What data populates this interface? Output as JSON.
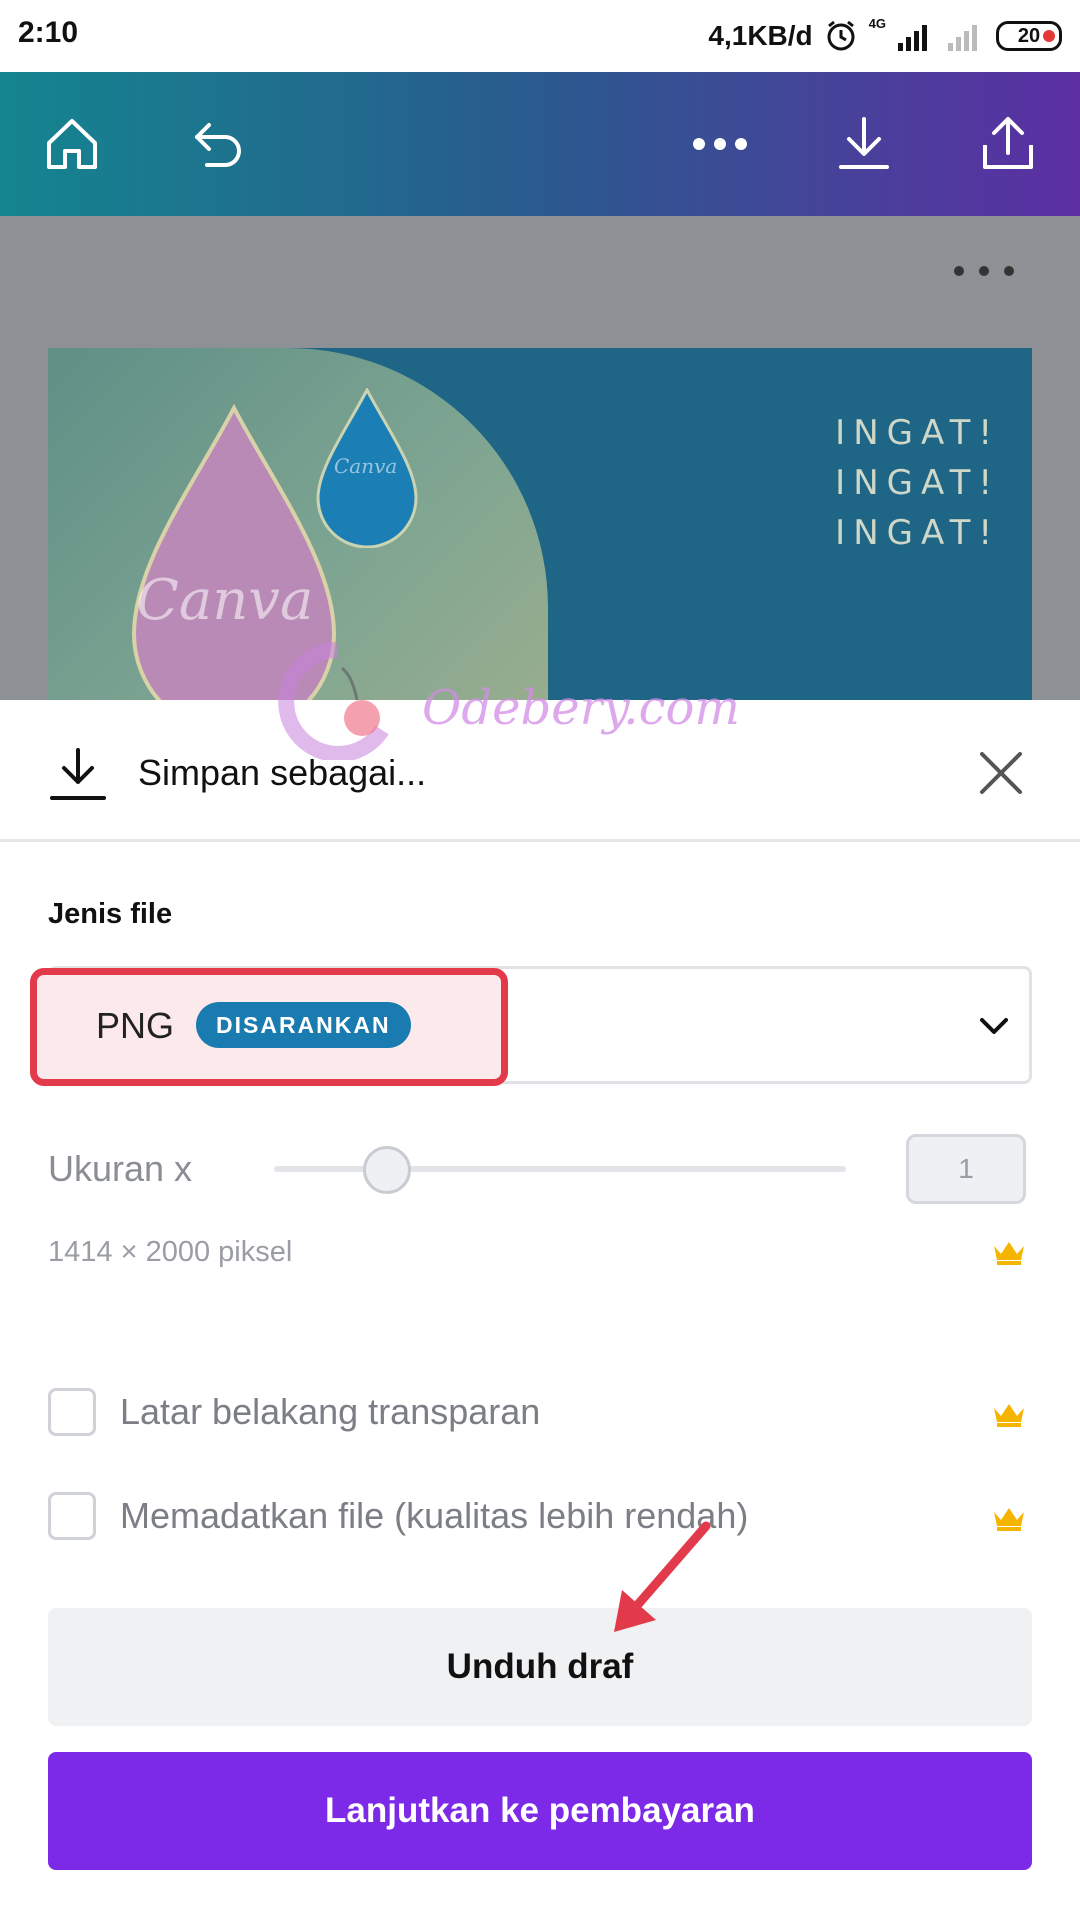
{
  "status_bar": {
    "time": "2:10",
    "net_speed": "4,1KB/d",
    "network": "4G",
    "battery": "20"
  },
  "toolbar": {
    "icons": [
      "home-icon",
      "undo-icon",
      "more-icon",
      "download-icon",
      "share-icon"
    ]
  },
  "design": {
    "headline_lines": [
      "INGAT!",
      "INGAT!",
      "INGAT!"
    ],
    "watermark_small": "Canva",
    "watermark_large": "Canva"
  },
  "overlay_watermark": "Odebery.com",
  "sheet": {
    "title": "Simpan sebagai...",
    "file_type_label": "Jenis file",
    "file_type_value": "PNG",
    "file_type_badge": "DISARANKAN",
    "size_label": "Ukuran x",
    "size_value": "1",
    "size_slider_fraction": 0.16,
    "pixels_text": "1414 × 2000 piksel",
    "option_transparent": "Latar belakang transparan",
    "option_compress": "Memadatkan file (kualitas lebih rendah)",
    "btn_draft": "Unduh draf",
    "btn_pay": "Lanjutkan ke pembayaran"
  },
  "colors": {
    "accent": "#7d2ae8",
    "badge": "#1a7bb0",
    "highlight": "#e23a4a",
    "crown": "#f4b400"
  }
}
